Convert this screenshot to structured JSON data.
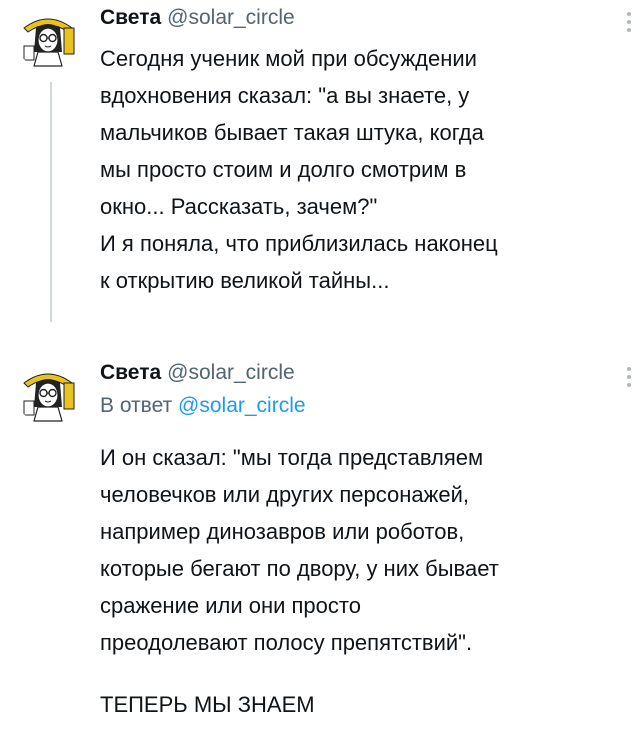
{
  "tweets": [
    {
      "author_name": "Света",
      "author_handle": "@solar_circle",
      "avatar_icon": "girl-with-glasses-sticker-avatar",
      "reply_to": null,
      "lines": [
        "Сегодня ученик мой при обсуждении",
        "вдохновения сказал: \"а вы знаете, у",
        "мальчиков бывает такая штука, когда",
        "мы просто стоим и долго смотрим в",
        "окно... Рассказать, зачем?\"",
        "И я поняла, что приблизилась наконец",
        "к открытию великой тайны..."
      ]
    },
    {
      "author_name": "Света",
      "author_handle": "@solar_circle",
      "avatar_icon": "girl-with-glasses-sticker-avatar",
      "reply_prefix": "В ответ",
      "reply_mention": "@solar_circle",
      "lines": [
        "И он сказал: \"мы тогда представляем",
        "человечков или других персонажей,",
        "например динозавров или роботов,",
        "которые бегают по двору, у них бывает",
        "сражение или они просто",
        "преодолевают полосу препятствий\"."
      ],
      "closing_line": "ТЕПЕРЬ МЫ ЗНАЕМ"
    }
  ],
  "colors": {
    "text": "#0f1419",
    "secondary": "#536471",
    "mention": "#1d9bf0",
    "thread_line": "#cfd9de"
  }
}
